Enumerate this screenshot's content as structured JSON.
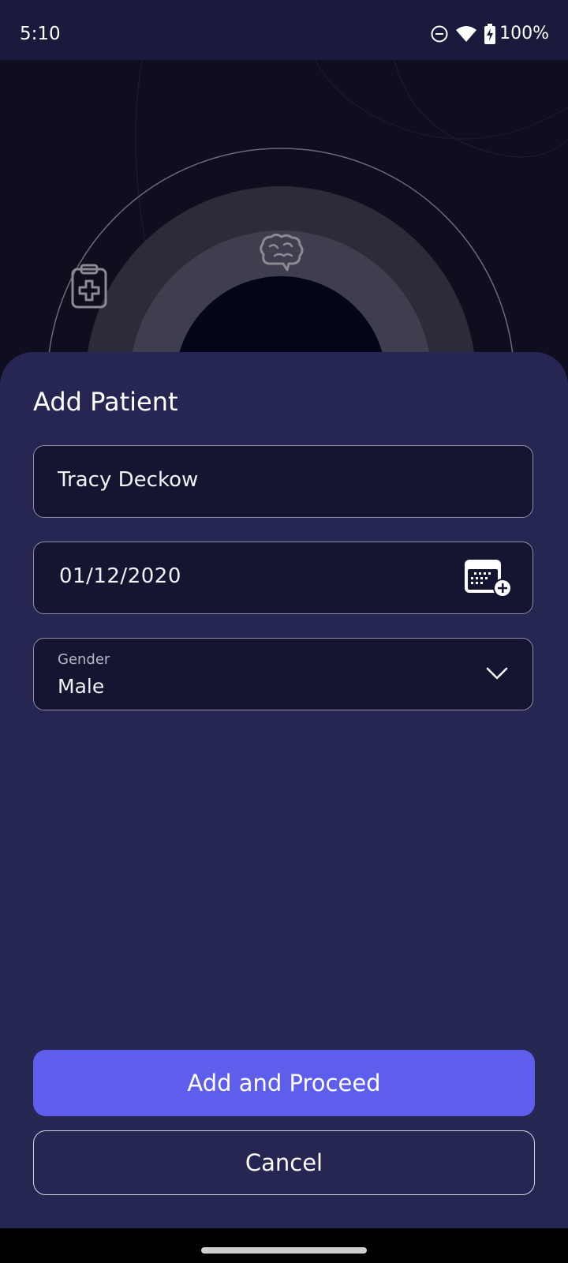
{
  "status_bar": {
    "time": "5:10",
    "battery": "100%",
    "icons": [
      "do-not-disturb-icon",
      "wifi-icon",
      "battery-charging-icon"
    ]
  },
  "hero": {
    "icons": [
      "clipboard-medical-icon",
      "brain-chat-icon"
    ]
  },
  "add_patient": {
    "title": "Add Patient",
    "name_value": "Tracy Deckow",
    "dob_value": "01/12/2020",
    "gender_label": "Gender",
    "gender_value": "Male",
    "primary_button": "Add and Proceed",
    "cancel_button": "Cancel"
  },
  "colors": {
    "accent": "#5e5eed",
    "sheet_background": "#262653",
    "field_background": "#151532",
    "status_bar_background": "#1a1a3c"
  }
}
